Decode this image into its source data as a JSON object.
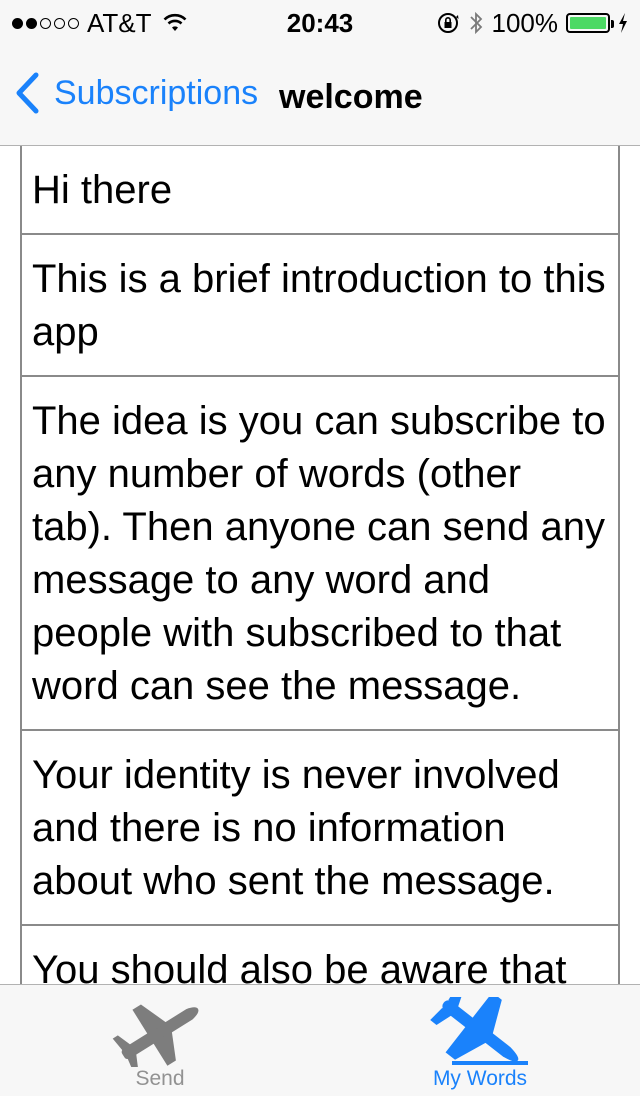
{
  "status_bar": {
    "carrier": "AT&T",
    "time": "20:43",
    "battery": "100%",
    "signal_bars": 2,
    "signal_total": 5
  },
  "nav": {
    "back_label": "Subscriptions",
    "title": "welcome"
  },
  "messages": [
    "Hi there",
    "This is a brief introduction to this app",
    "The idea is you can subscribe to any number of words (other tab). Then anyone can send any message to any word and people with subscribed to that word can see the message.",
    "Your identity is never involved and there is no information about who sent the message.",
    "You should also be aware that"
  ],
  "tabs": [
    {
      "label": "Send",
      "icon": "airplane-takeoff-icon",
      "selected": false
    },
    {
      "label": "My Words",
      "icon": "airplane-landing-icon",
      "selected": true
    }
  ],
  "colors": {
    "accent": "#1a82fb",
    "inactive": "#929292",
    "battery": "#4cd964"
  }
}
